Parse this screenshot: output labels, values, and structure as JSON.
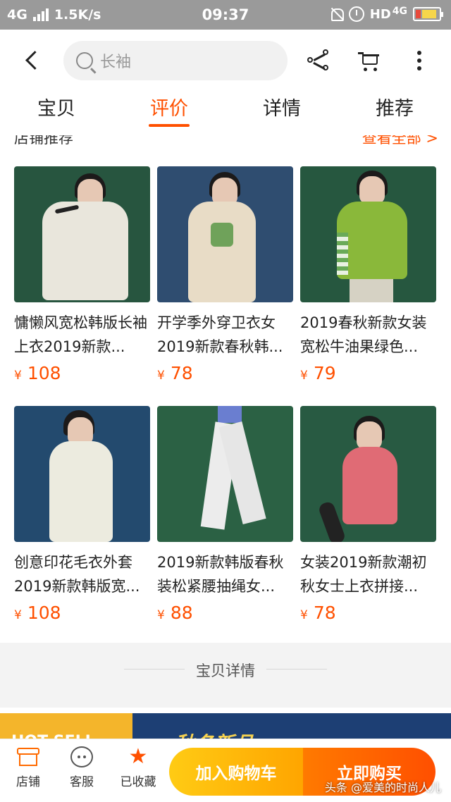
{
  "status_bar": {
    "network": "4G",
    "speed": "1.5K/s",
    "time": "09:37",
    "hd_label": "HD",
    "right_network": "4G"
  },
  "nav": {
    "search_placeholder": "长袖",
    "tabs": [
      {
        "label": "宝贝",
        "active": false
      },
      {
        "label": "评价",
        "active": true
      },
      {
        "label": "详情",
        "active": false
      },
      {
        "label": "推荐",
        "active": false
      }
    ]
  },
  "store_recommend": {
    "title": "店铺推荐",
    "more": "查看全部 >"
  },
  "currency": "¥",
  "products": [
    {
      "title": "慵懒风宽松韩版长袖上衣2019新款...",
      "price": "108"
    },
    {
      "title": "开学季外穿卫衣女2019新款春秋韩...",
      "price": "78"
    },
    {
      "title": "2019春秋新款女装宽松牛油果绿色...",
      "price": "79"
    },
    {
      "title": "创意印花毛衣外套2019新款韩版宽...",
      "price": "108"
    },
    {
      "title": "2019新款韩版春秋装松紧腰抽绳女...",
      "price": "88"
    },
    {
      "title": "女装2019新款潮初秋女士上衣拼接...",
      "price": "78"
    }
  ],
  "detail_divider": "宝贝详情",
  "banner": {
    "left_text": "HOT SELL",
    "right_text": "秋冬新品"
  },
  "bottom_bar": {
    "store": "店铺",
    "service": "客服",
    "favorited": "已收藏",
    "add_to_cart": "加入购物车",
    "buy_now": "立即购买"
  },
  "watermark": "头条 @爱美的时尚人儿",
  "colors": {
    "accent": "#ff5000",
    "cart_button": "#ffb400",
    "buy_button": "#ff5a00"
  }
}
